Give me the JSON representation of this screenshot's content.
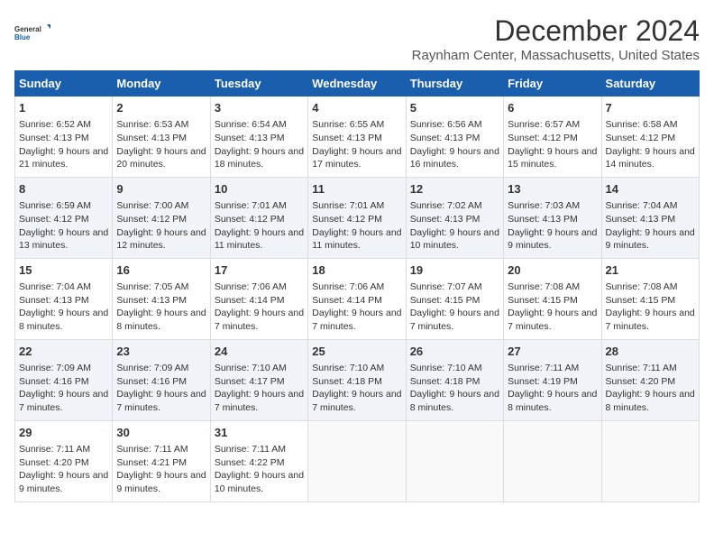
{
  "logo": {
    "line1": "General",
    "line2": "Blue"
  },
  "title": "December 2024",
  "subtitle": "Raynham Center, Massachusetts, United States",
  "days_header": [
    "Sunday",
    "Monday",
    "Tuesday",
    "Wednesday",
    "Thursday",
    "Friday",
    "Saturday"
  ],
  "weeks": [
    [
      {
        "day": "1",
        "sunrise": "6:52 AM",
        "sunset": "4:13 PM",
        "daylight": "9 hours and 21 minutes."
      },
      {
        "day": "2",
        "sunrise": "6:53 AM",
        "sunset": "4:13 PM",
        "daylight": "9 hours and 20 minutes."
      },
      {
        "day": "3",
        "sunrise": "6:54 AM",
        "sunset": "4:13 PM",
        "daylight": "9 hours and 18 minutes."
      },
      {
        "day": "4",
        "sunrise": "6:55 AM",
        "sunset": "4:13 PM",
        "daylight": "9 hours and 17 minutes."
      },
      {
        "day": "5",
        "sunrise": "6:56 AM",
        "sunset": "4:13 PM",
        "daylight": "9 hours and 16 minutes."
      },
      {
        "day": "6",
        "sunrise": "6:57 AM",
        "sunset": "4:12 PM",
        "daylight": "9 hours and 15 minutes."
      },
      {
        "day": "7",
        "sunrise": "6:58 AM",
        "sunset": "4:12 PM",
        "daylight": "9 hours and 14 minutes."
      }
    ],
    [
      {
        "day": "8",
        "sunrise": "6:59 AM",
        "sunset": "4:12 PM",
        "daylight": "9 hours and 13 minutes."
      },
      {
        "day": "9",
        "sunrise": "7:00 AM",
        "sunset": "4:12 PM",
        "daylight": "9 hours and 12 minutes."
      },
      {
        "day": "10",
        "sunrise": "7:01 AM",
        "sunset": "4:12 PM",
        "daylight": "9 hours and 11 minutes."
      },
      {
        "day": "11",
        "sunrise": "7:01 AM",
        "sunset": "4:12 PM",
        "daylight": "9 hours and 11 minutes."
      },
      {
        "day": "12",
        "sunrise": "7:02 AM",
        "sunset": "4:13 PM",
        "daylight": "9 hours and 10 minutes."
      },
      {
        "day": "13",
        "sunrise": "7:03 AM",
        "sunset": "4:13 PM",
        "daylight": "9 hours and 9 minutes."
      },
      {
        "day": "14",
        "sunrise": "7:04 AM",
        "sunset": "4:13 PM",
        "daylight": "9 hours and 9 minutes."
      }
    ],
    [
      {
        "day": "15",
        "sunrise": "7:04 AM",
        "sunset": "4:13 PM",
        "daylight": "9 hours and 8 minutes."
      },
      {
        "day": "16",
        "sunrise": "7:05 AM",
        "sunset": "4:13 PM",
        "daylight": "9 hours and 8 minutes."
      },
      {
        "day": "17",
        "sunrise": "7:06 AM",
        "sunset": "4:14 PM",
        "daylight": "9 hours and 7 minutes."
      },
      {
        "day": "18",
        "sunrise": "7:06 AM",
        "sunset": "4:14 PM",
        "daylight": "9 hours and 7 minutes."
      },
      {
        "day": "19",
        "sunrise": "7:07 AM",
        "sunset": "4:15 PM",
        "daylight": "9 hours and 7 minutes."
      },
      {
        "day": "20",
        "sunrise": "7:08 AM",
        "sunset": "4:15 PM",
        "daylight": "9 hours and 7 minutes."
      },
      {
        "day": "21",
        "sunrise": "7:08 AM",
        "sunset": "4:15 PM",
        "daylight": "9 hours and 7 minutes."
      }
    ],
    [
      {
        "day": "22",
        "sunrise": "7:09 AM",
        "sunset": "4:16 PM",
        "daylight": "9 hours and 7 minutes."
      },
      {
        "day": "23",
        "sunrise": "7:09 AM",
        "sunset": "4:16 PM",
        "daylight": "9 hours and 7 minutes."
      },
      {
        "day": "24",
        "sunrise": "7:10 AM",
        "sunset": "4:17 PM",
        "daylight": "9 hours and 7 minutes."
      },
      {
        "day": "25",
        "sunrise": "7:10 AM",
        "sunset": "4:18 PM",
        "daylight": "9 hours and 7 minutes."
      },
      {
        "day": "26",
        "sunrise": "7:10 AM",
        "sunset": "4:18 PM",
        "daylight": "9 hours and 8 minutes."
      },
      {
        "day": "27",
        "sunrise": "7:11 AM",
        "sunset": "4:19 PM",
        "daylight": "9 hours and 8 minutes."
      },
      {
        "day": "28",
        "sunrise": "7:11 AM",
        "sunset": "4:20 PM",
        "daylight": "9 hours and 8 minutes."
      }
    ],
    [
      {
        "day": "29",
        "sunrise": "7:11 AM",
        "sunset": "4:20 PM",
        "daylight": "9 hours and 9 minutes."
      },
      {
        "day": "30",
        "sunrise": "7:11 AM",
        "sunset": "4:21 PM",
        "daylight": "9 hours and 9 minutes."
      },
      {
        "day": "31",
        "sunrise": "7:11 AM",
        "sunset": "4:22 PM",
        "daylight": "9 hours and 10 minutes."
      },
      null,
      null,
      null,
      null
    ]
  ],
  "labels": {
    "sunrise": "Sunrise:",
    "sunset": "Sunset:",
    "daylight": "Daylight:"
  },
  "accent_color": "#1a5fad"
}
